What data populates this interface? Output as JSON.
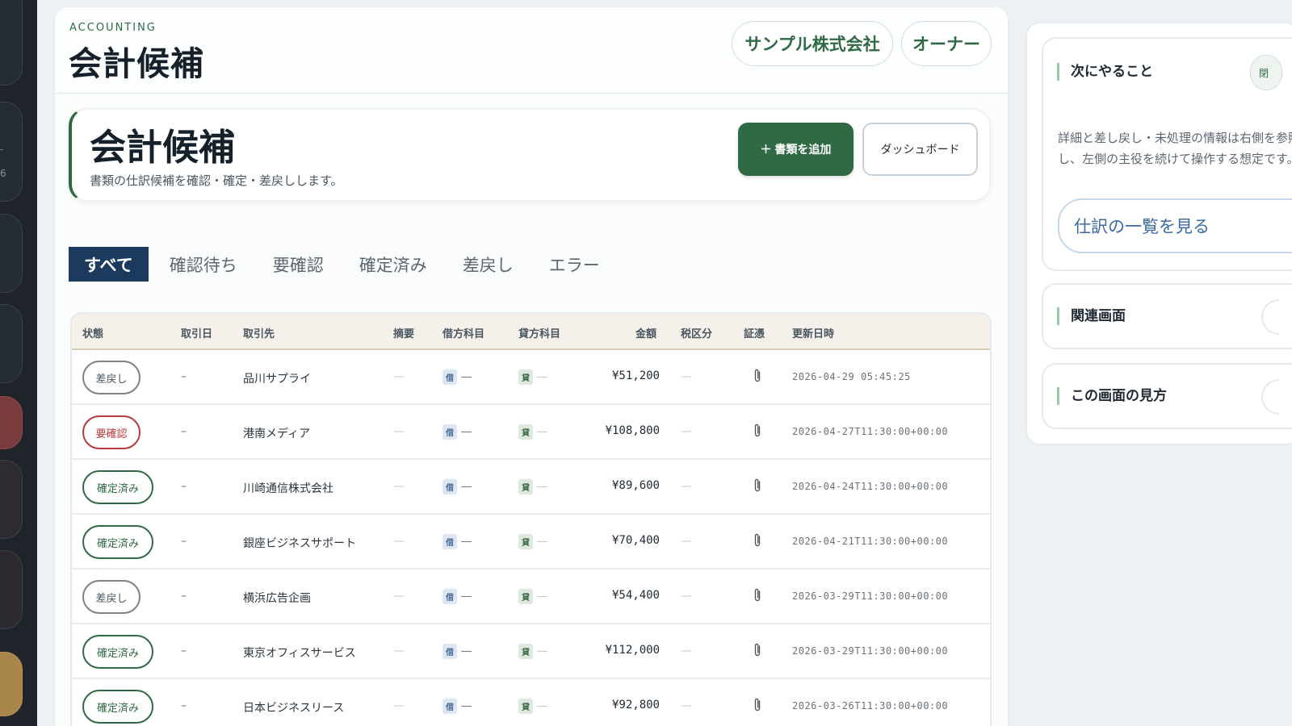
{
  "rail": {
    "glyph_a": "-",
    "glyph_b": "6"
  },
  "header": {
    "eyebrow": "ACCOUNTING",
    "title": "会計候補",
    "company": "サンプル株式会社",
    "role": "オーナー"
  },
  "hero": {
    "title": "会計候補",
    "subtitle": "書類の仕訳候補を確認・確定・差戻しします。",
    "add_button": "＋ 書類を追加",
    "dashboard_button": "ダッシュボード"
  },
  "tabs": [
    {
      "label": "すべて",
      "active": true
    },
    {
      "label": "確認待ち",
      "active": false
    },
    {
      "label": "要確認",
      "active": false
    },
    {
      "label": "確定済み",
      "active": false
    },
    {
      "label": "差戻し",
      "active": false
    },
    {
      "label": "エラー",
      "active": false
    }
  ],
  "table": {
    "columns": [
      "状態",
      "取引日",
      "取引先",
      "摘要",
      "借方科目",
      "貸方科目",
      "金額",
      "税区分",
      "証憑",
      "更新日時"
    ],
    "debit_tag": "借",
    "credit_tag": "貸",
    "rows": [
      {
        "status": "差戻し",
        "status_kind": "return",
        "date": "–",
        "partner": "品川サプライ",
        "memo": "—",
        "debit": "—",
        "credit": "—",
        "amount": "¥51,200",
        "tax": "—",
        "updated": "2026-04-29 05:45:25"
      },
      {
        "status": "要確認",
        "status_kind": "check",
        "date": "–",
        "partner": "港南メディア",
        "memo": "—",
        "debit": "—",
        "credit": "—",
        "amount": "¥108,800",
        "tax": "—",
        "updated": "2026-04-27T11:30:00+00:00"
      },
      {
        "status": "確定済み",
        "status_kind": "done",
        "date": "–",
        "partner": "川崎通信株式会社",
        "memo": "—",
        "debit": "—",
        "credit": "—",
        "amount": "¥89,600",
        "tax": "—",
        "updated": "2026-04-24T11:30:00+00:00"
      },
      {
        "status": "確定済み",
        "status_kind": "done",
        "date": "–",
        "partner": "銀座ビジネスサポート",
        "memo": "—",
        "debit": "—",
        "credit": "—",
        "amount": "¥70,400",
        "tax": "—",
        "updated": "2026-04-21T11:30:00+00:00"
      },
      {
        "status": "差戻し",
        "status_kind": "return",
        "date": "–",
        "partner": "横浜広告企画",
        "memo": "—",
        "debit": "—",
        "credit": "—",
        "amount": "¥54,400",
        "tax": "—",
        "updated": "2026-03-29T11:30:00+00:00"
      },
      {
        "status": "確定済み",
        "status_kind": "done",
        "date": "–",
        "partner": "東京オフィスサービス",
        "memo": "—",
        "debit": "—",
        "credit": "—",
        "amount": "¥112,000",
        "tax": "—",
        "updated": "2026-03-29T11:30:00+00:00"
      },
      {
        "status": "確定済み",
        "status_kind": "done",
        "date": "–",
        "partner": "日本ビジネスリース",
        "memo": "—",
        "debit": "—",
        "credit": "—",
        "amount": "¥92,800",
        "tax": "—",
        "updated": "2026-03-26T11:30:00+00:00"
      }
    ]
  },
  "side": {
    "next_title": "次にやること",
    "next_chip": "閉",
    "next_text": "詳細と差し戻し・未処理の情報は右側を参照し、左側の主役を続けて操作する想定です。",
    "next_link": "仕訳の一覧を見る",
    "related_title": "関連画面",
    "howto_title": "この画面の見方"
  },
  "colors": {
    "brand": "#2f6a45",
    "tab_active": "#1c3a5e",
    "danger": "#b73a3a",
    "link": "#3b6aa3"
  }
}
